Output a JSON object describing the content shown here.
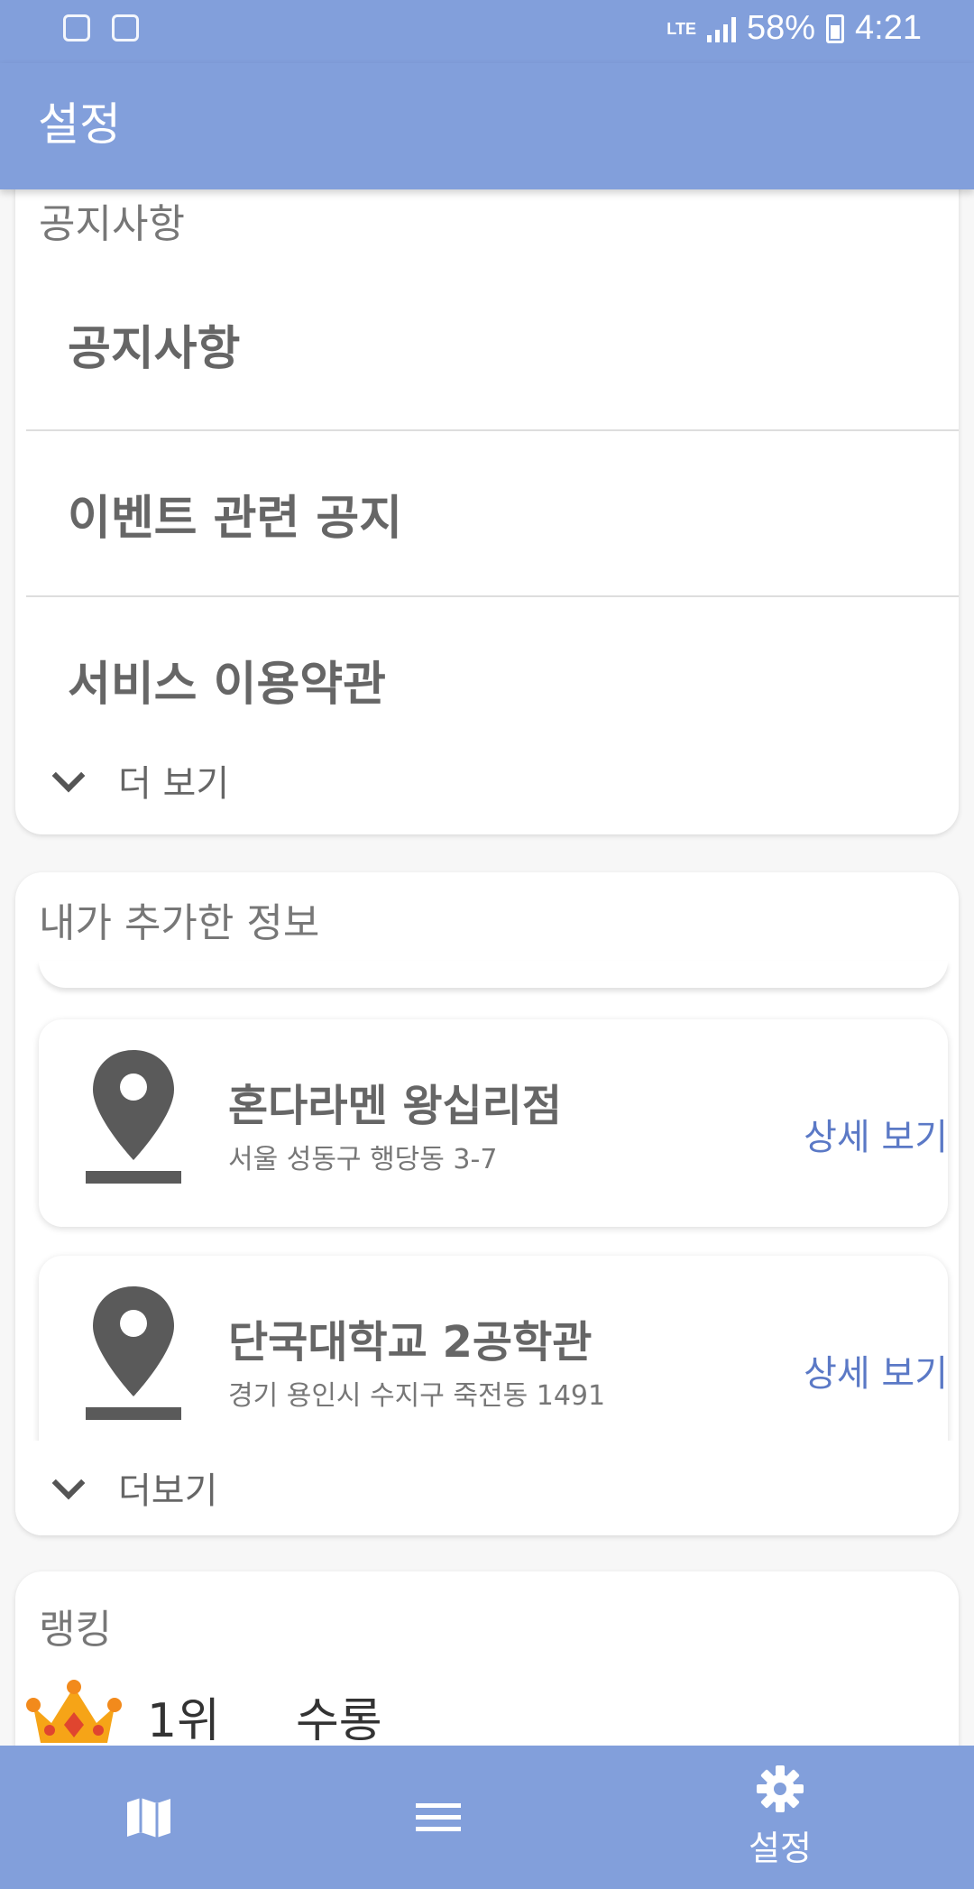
{
  "status_bar": {
    "network": "LTE",
    "battery": "58%",
    "time": "4:21"
  },
  "app_bar": {
    "title": "설정"
  },
  "notice_section": {
    "title": "공지사항",
    "items": [
      {
        "label": "공지사항"
      },
      {
        "label": "이벤트 관련 공지"
      },
      {
        "label": "서비스 이용약관"
      }
    ],
    "more_label": "더 보기"
  },
  "info_section": {
    "title": "내가 추가한 정보",
    "places": [
      {
        "name": "혼다라멘 왕십리점",
        "address": "서울 성동구 행당동 3-7",
        "detail_label": "상세 보기"
      },
      {
        "name": "단국대학교 2공학관",
        "address": "경기 용인시 수지구 죽전동 1491",
        "detail_label": "상세 보기"
      }
    ],
    "more_label": "더보기"
  },
  "ranking_section": {
    "title": "랭킹",
    "entries": [
      {
        "rank": "1위",
        "name": "수롱"
      }
    ]
  },
  "bottom_nav": {
    "items": [
      {
        "icon": "map-icon",
        "label": ""
      },
      {
        "icon": "menu-icon",
        "label": ""
      },
      {
        "icon": "gear-icon",
        "label": "설정"
      }
    ]
  },
  "colors": {
    "primary": "#829fdb",
    "link": "#5b79c6"
  }
}
